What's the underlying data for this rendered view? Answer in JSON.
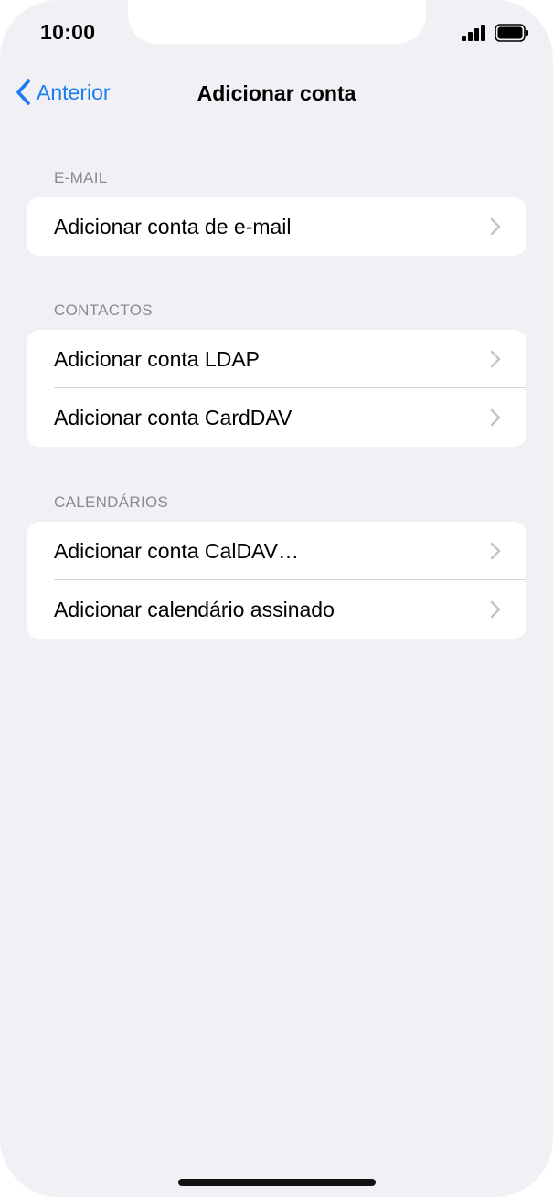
{
  "status": {
    "time": "10:00",
    "signal_icon": "cellular-signal-icon",
    "battery_icon": "battery-icon"
  },
  "navbar": {
    "back_label": "Anterior",
    "title": "Adicionar conta"
  },
  "sections": [
    {
      "header": "E-MAIL",
      "items": [
        {
          "label": "Adicionar conta de e-mail"
        }
      ]
    },
    {
      "header": "CONTACTOS",
      "items": [
        {
          "label": "Adicionar conta LDAP"
        },
        {
          "label": "Adicionar conta CardDAV"
        }
      ]
    },
    {
      "header": "CALENDÁRIOS",
      "items": [
        {
          "label": "Adicionar conta CalDAV…"
        },
        {
          "label": "Adicionar calendário assinado"
        }
      ]
    }
  ],
  "colors": {
    "accent": "#1a7cf2",
    "background": "#f0f0f5",
    "header_text": "#8a8a8e"
  }
}
